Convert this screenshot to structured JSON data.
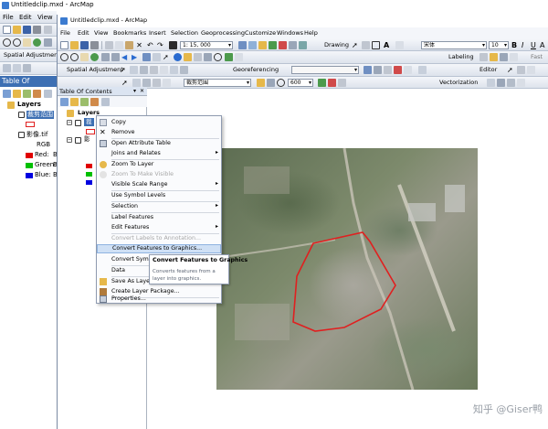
{
  "back_window": {
    "title": "Untitledclip.mxd - ArcMap",
    "menu": [
      "File",
      "Edit",
      "View"
    ],
    "spatial_adjustment": "Spatial Adjustment",
    "toc_title": "Table Of Contents",
    "layers_label": "Layers",
    "layer1_name": "裁剪范围",
    "layer2_name": "影像.tif",
    "rgb_label": "RGB",
    "red_label": "Red:",
    "red_value": "Ba",
    "green_label": "Green:",
    "green_value": "Ba",
    "blue_label": "Blue:",
    "blue_value": "Ba"
  },
  "front_window": {
    "title": "Untitledclip.mxd - ArcMap",
    "menu": [
      "File",
      "Edit",
      "View",
      "Bookmarks",
      "Insert",
      "Selection",
      "Geoprocessing",
      "Customize",
      "Windows",
      "Help"
    ],
    "scale": "1: 15, 000",
    "drawing_label": "Drawing",
    "font_name": "宋体",
    "font_size": "10",
    "labeling_label": "Labeling",
    "fast_label": "Fast",
    "spatial_adjustment": "Spatial Adjustment",
    "georeferencing_label": "Georeferencing",
    "editor_label": "Editor",
    "georef_layer": "裁剪范围",
    "zoom_percent": "600",
    "vectorization_label": "Vectorization",
    "toc_title": "Table Of Contents",
    "layers_label": "Layers",
    "layer1_short": "裁",
    "layer2_short": "影"
  },
  "context_menu": {
    "items": [
      {
        "label": "Copy",
        "icon": "copy-icon",
        "enabled": true,
        "submenu": false
      },
      {
        "label": "Remove",
        "icon": "remove-icon",
        "enabled": true,
        "submenu": false
      },
      {
        "label": "Open Attribute Table",
        "icon": "table-icon",
        "enabled": true,
        "submenu": false
      },
      {
        "label": "Joins and Relates",
        "icon": "",
        "enabled": true,
        "submenu": true
      },
      {
        "label": "Zoom To Layer",
        "icon": "zoom-layer-icon",
        "enabled": true,
        "submenu": false
      },
      {
        "label": "Zoom To Make Visible",
        "icon": "zoom-visible-icon",
        "enabled": false,
        "submenu": false
      },
      {
        "label": "Visible Scale Range",
        "icon": "",
        "enabled": true,
        "submenu": true
      },
      {
        "label": "Use Symbol Levels",
        "icon": "",
        "enabled": true,
        "submenu": false
      },
      {
        "label": "Selection",
        "icon": "",
        "enabled": true,
        "submenu": true
      },
      {
        "label": "Label Features",
        "icon": "",
        "enabled": true,
        "submenu": false
      },
      {
        "label": "Edit Features",
        "icon": "",
        "enabled": true,
        "submenu": true
      },
      {
        "label": "Convert Labels to Annotation...",
        "icon": "",
        "enabled": false,
        "submenu": false
      },
      {
        "label": "Convert Features to Graphics...",
        "icon": "",
        "enabled": true,
        "submenu": false,
        "highlighted": true
      },
      {
        "label": "Convert Symbol",
        "icon": "",
        "enabled": true,
        "submenu": false
      },
      {
        "label": "Data",
        "icon": "",
        "enabled": true,
        "submenu": true
      },
      {
        "label": "Save As Layer F",
        "icon": "save-layer-icon",
        "enabled": true,
        "submenu": false
      },
      {
        "label": "Create Layer Package...",
        "icon": "package-icon",
        "enabled": true,
        "submenu": false
      },
      {
        "label": "Properties...",
        "icon": "properties-icon",
        "enabled": true,
        "submenu": false
      }
    ]
  },
  "tooltip": {
    "heading": "Convert Features to Graphics",
    "description": "Converts features from a layer into graphics."
  },
  "watermark": "知乎 @Giser鸭",
  "colors": {
    "toc_title_bg": "#3d6fb3",
    "selection_red": "#e02020",
    "highlight": "#cfe0f5",
    "red_swatch": "#e00000",
    "green_swatch": "#00c000",
    "blue_swatch": "#0000e0"
  }
}
